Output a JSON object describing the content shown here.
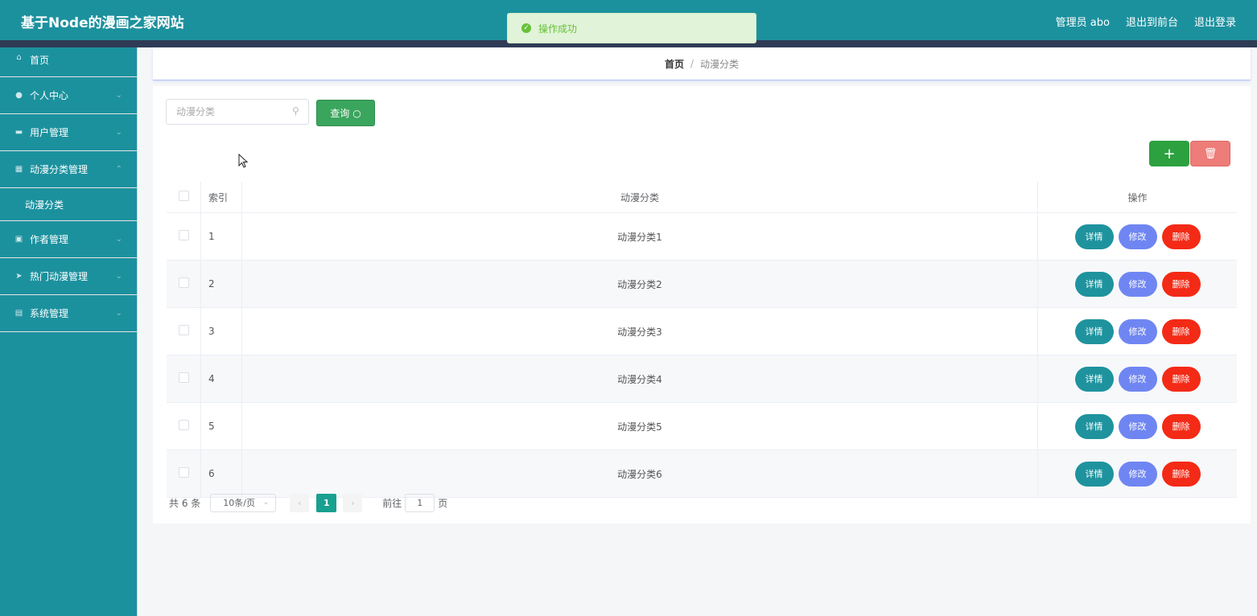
{
  "header": {
    "title": "基于Node的漫画之家网站",
    "user_label": "管理员 abo",
    "back_label": "退出到前台",
    "logout_label": "退出登录"
  },
  "toast": {
    "message": "操作成功"
  },
  "sidebar": {
    "items": [
      {
        "label": "首页",
        "icon": "home-icon"
      },
      {
        "label": "个人中心",
        "icon": "user-icon"
      },
      {
        "label": "用户管理",
        "icon": "users-icon"
      },
      {
        "label": "动漫分类管理",
        "icon": "grid-icon"
      },
      {
        "label": "作者管理",
        "icon": "author-icon"
      },
      {
        "label": "热门动漫管理",
        "icon": "send-icon"
      },
      {
        "label": "系统管理",
        "icon": "clipboard-icon"
      }
    ],
    "sub_item": "动漫分类"
  },
  "breadcrumb": {
    "home": "首页",
    "separator": "/",
    "current": "动漫分类"
  },
  "search": {
    "placeholder": "动漫分类",
    "button": "查询"
  },
  "table": {
    "headers": {
      "index": "索引",
      "name": "动漫分类",
      "ops": "操作"
    },
    "rows": [
      {
        "index": "1",
        "name": "动漫分类1"
      },
      {
        "index": "2",
        "name": "动漫分类2"
      },
      {
        "index": "3",
        "name": "动漫分类3"
      },
      {
        "index": "4",
        "name": "动漫分类4"
      },
      {
        "index": "5",
        "name": "动漫分类5"
      },
      {
        "index": "6",
        "name": "动漫分类6"
      }
    ],
    "op_labels": {
      "detail": "详情",
      "edit": "修改",
      "delete": "删除"
    }
  },
  "pagination": {
    "total": "共 6 条",
    "page_size": "10条/页",
    "current_page": "1",
    "goto_prefix": "前往",
    "goto_value": "1",
    "goto_suffix": "页"
  },
  "colors": {
    "primary": "#1c919e",
    "header_stripe": "#2f3a55",
    "query_button": "#3aa55d",
    "add_button": "#2da13f",
    "batch_delete": "#ee7c78",
    "op_detail": "#1e939e",
    "op_edit": "#6f86f2",
    "op_delete": "#f32a16",
    "active_page": "#18a090"
  }
}
